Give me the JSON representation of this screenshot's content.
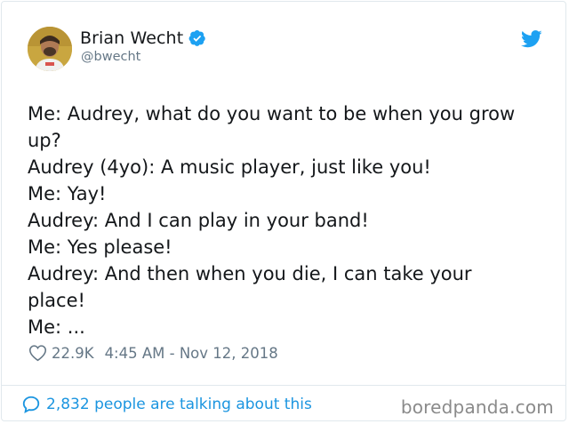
{
  "author": {
    "name": "Brian Wecht",
    "handle": "@bwecht",
    "verified": true,
    "avatar_icon": "avatar-photo"
  },
  "tweet": {
    "lines": [
      "Me: Audrey, what do you want to be when you grow",
      "up?",
      "Audrey (4yo): A music player, just like you!",
      "Me: Yay!",
      "Audrey: And I can play in your band!",
      "Me: Yes please!",
      "Audrey: And then when you die, I can take your",
      "place!",
      "Me: ..."
    ]
  },
  "meta": {
    "likes": "22.9K",
    "timestamp": "4:45 AM - Nov 12, 2018"
  },
  "footer": {
    "talking": "2,832 people are talking about this"
  },
  "watermark": "boredpanda.com",
  "colors": {
    "text": "#14171a",
    "muted": "#657786",
    "link": "#1b95e0",
    "twitter_blue": "#1da1f2"
  }
}
